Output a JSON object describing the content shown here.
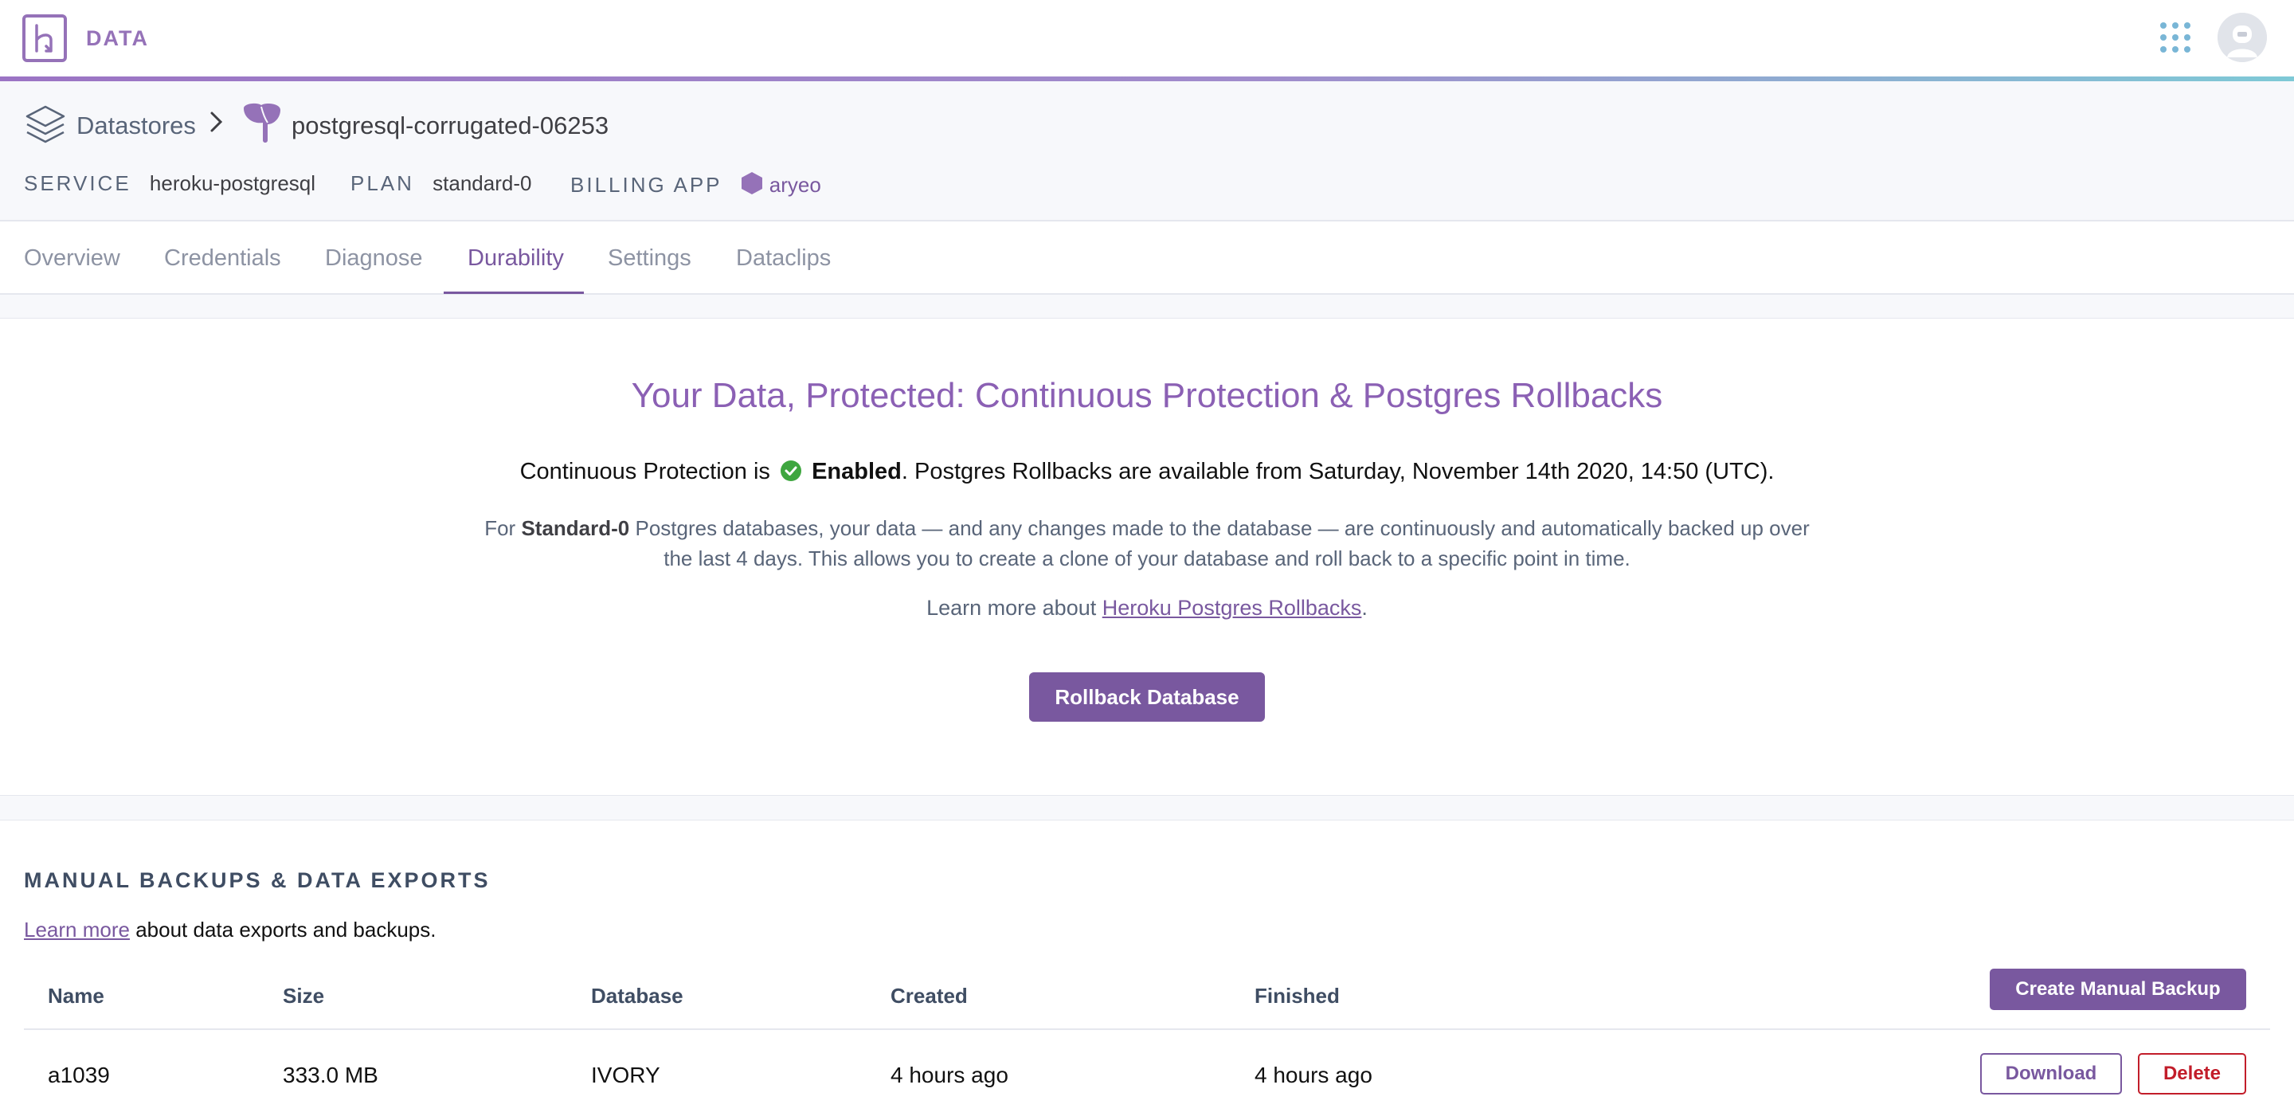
{
  "app": {
    "brand": "DATA"
  },
  "breadcrumb": {
    "root": "Datastores",
    "current": "postgresql-corrugated-06253"
  },
  "meta": {
    "service_label": "SERVICE",
    "service_value": "heroku-postgresql",
    "plan_label": "PLAN",
    "plan_value": "standard-0",
    "billing_label": "BILLING APP",
    "billing_value": "aryeo"
  },
  "tabs": [
    {
      "label": "Overview"
    },
    {
      "label": "Credentials"
    },
    {
      "label": "Diagnose"
    },
    {
      "label": "Durability",
      "active": true
    },
    {
      "label": "Settings"
    },
    {
      "label": "Dataclips"
    }
  ],
  "hero": {
    "title": "Your Data, Protected: Continuous Protection & Postgres Rollbacks",
    "status_prefix": "Continuous Protection is",
    "status_value": "Enabled",
    "status_suffix": ". Postgres Rollbacks are available from Saturday, November 14th 2020, 14:50 (UTC).",
    "desc_prefix": "For",
    "desc_plan": "Standard-0",
    "desc_rest": "Postgres databases, your data — and any changes made to the database — are continuously and automatically backed up over the last 4 days. This allows you to create a clone of your database and roll back to a specific point in time.",
    "learn_prefix": "Learn more about",
    "learn_link": "Heroku Postgres Rollbacks",
    "learn_suffix": ".",
    "rollback_button": "Rollback Database"
  },
  "backups": {
    "title": "MANUAL BACKUPS & DATA EXPORTS",
    "learn_link": "Learn more",
    "learn_rest": "about data exports and backups.",
    "columns": [
      "Name",
      "Size",
      "Database",
      "Created",
      "Finished"
    ],
    "create_button": "Create Manual Backup",
    "rows": [
      {
        "name": "a1039",
        "size": "333.0 MB",
        "database": "IVORY",
        "created": "4 hours ago",
        "finished": "4 hours ago"
      }
    ],
    "download_button": "Download",
    "delete_button": "Delete"
  },
  "colors": {
    "accent": "#79589f",
    "title": "#8b60b4",
    "success": "#3ea63f",
    "danger": "#c21d2a",
    "apps_grid": "#79b6d6"
  },
  "icons": [
    "heroku-logo-icon",
    "apps-grid-icon",
    "avatar-icon",
    "datastores-stack-icon",
    "chevron-right-icon",
    "postgres-elephant-icon",
    "app-hexagon-icon",
    "check-circle-icon"
  ]
}
